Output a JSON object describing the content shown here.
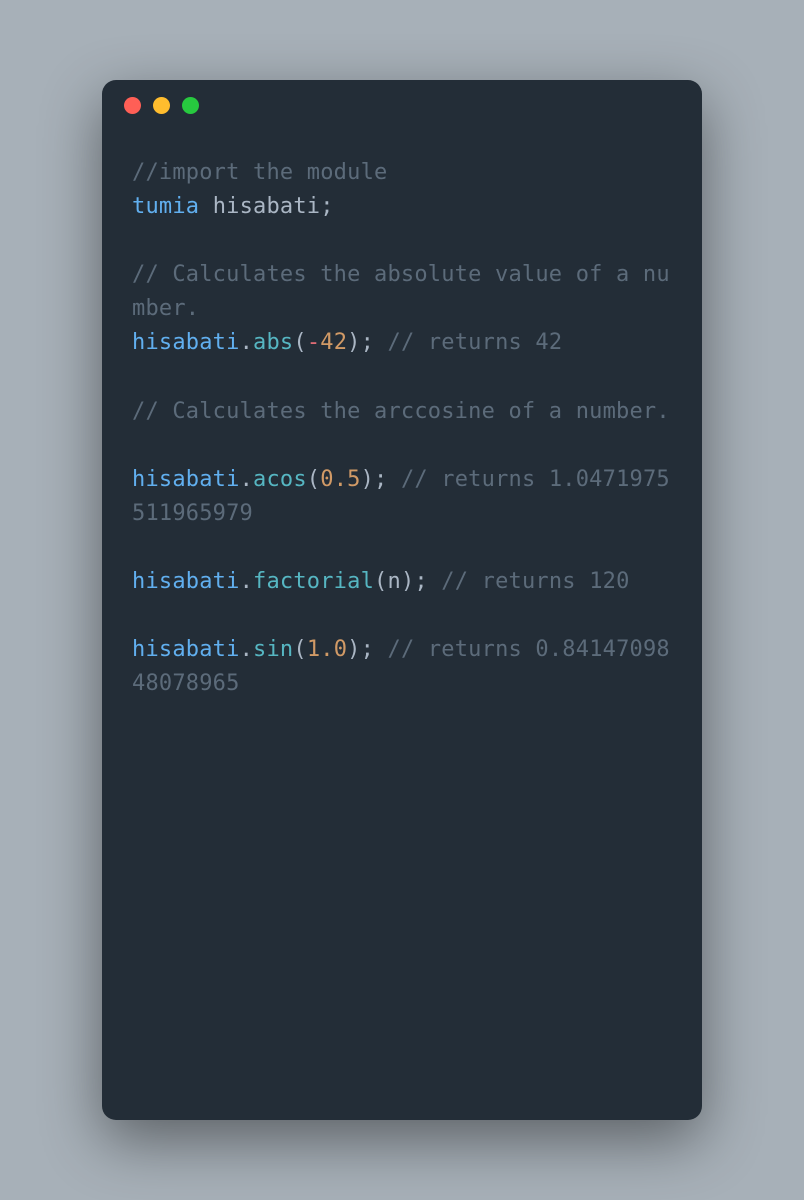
{
  "window": {
    "traffic_lights": [
      "close",
      "minimize",
      "zoom"
    ]
  },
  "code": {
    "l1_comment": "//import the module",
    "l2_kw": "tumia",
    "l2_sp": " ",
    "l2_ident": "hisabati",
    "l2_semi": ";",
    "blank1": "",
    "l3_comment": "// Calculates the absolute value of a number.",
    "l4_obj": "hisabati",
    "l4_dot": ".",
    "l4_fn": "abs",
    "l4_open": "(",
    "l4_neg": "-",
    "l4_num": "42",
    "l4_close": ")",
    "l4_semi": ";",
    "l4_sp": " ",
    "l4_ret": "// returns 42",
    "blank2": "",
    "l5_comment": "// Calculates the arccosine of a number.",
    "blank3": "",
    "l6_obj": "hisabati",
    "l6_dot": ".",
    "l6_fn": "acos",
    "l6_open": "(",
    "l6_num": "0.5",
    "l6_close": ")",
    "l6_semi": ";",
    "l6_sp": " ",
    "l6_ret": "// returns 1.0471975511965979",
    "blank4": "",
    "l7_obj": "hisabati",
    "l7_dot": ".",
    "l7_fn": "factorial",
    "l7_open": "(",
    "l7_arg": "n",
    "l7_close": ")",
    "l7_semi": ";",
    "l7_sp": " ",
    "l7_ret": "// returns 120",
    "blank5": "",
    "l8_obj": "hisabati",
    "l8_dot": ".",
    "l8_fn": "sin",
    "l8_open": "(",
    "l8_num": "1.0",
    "l8_close": ")",
    "l8_semi": ";",
    "l8_sp": " ",
    "l8_ret": "// returns 0.8414709848078965"
  }
}
